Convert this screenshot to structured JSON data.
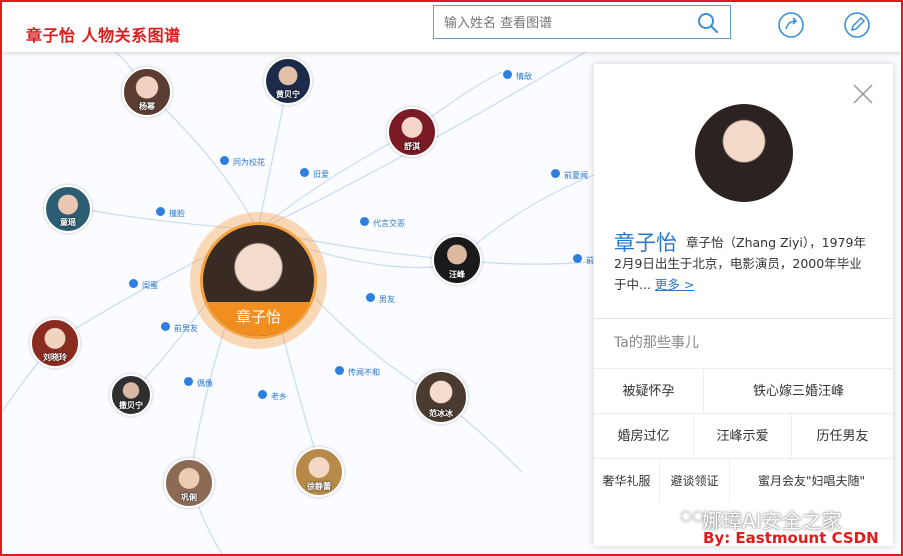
{
  "header": {
    "brand": "章子怡 人物关系图谱",
    "search_placeholder": "输入姓名 查看图谱",
    "icons": [
      "share-icon",
      "edit-icon",
      "search-icon"
    ]
  },
  "graph": {
    "center": {
      "name": "章子怡",
      "color": "#f28d1f"
    },
    "people": [
      {
        "name": "杨幂"
      },
      {
        "name": "黄贝宁"
      },
      {
        "name": "舒淇"
      },
      {
        "name": "童瑶"
      },
      {
        "name": "汪峰"
      },
      {
        "name": "刘晓玲"
      },
      {
        "name": "撒贝宁"
      },
      {
        "name": "范冰冰"
      },
      {
        "name": "巩俐"
      },
      {
        "name": "徐静蕾"
      }
    ],
    "relations": [
      "同为校花",
      "旧爱",
      "情敌",
      "撞脸",
      "代言交恶",
      "前夏闻",
      "闺蜜",
      "男友",
      "前男友",
      "偶像",
      "老乡",
      "传闻不和",
      "前"
    ]
  },
  "panel": {
    "name": "章子怡",
    "description": "章子怡（Zhang Ziyi），1979年2月9日出生于北京，电影演员，2000年毕业于中...",
    "more": "更多 >",
    "section_title": "Ta的那些事儿",
    "tags": [
      "被疑怀孕",
      "铁心嫁三婚汪峰",
      "婚房过亿",
      "汪峰示爱",
      "历任男友",
      "奢华礼服",
      "避谈领证",
      "蜜月会友\"妇唱夫随\""
    ]
  },
  "watermark": {
    "wechat": "娜璋AI安全之家",
    "credit": "By: Eastmount CSDN"
  },
  "colors": {
    "brand": "#d81e1e",
    "accent": "#2a78c8",
    "center": "#f28d1f"
  }
}
